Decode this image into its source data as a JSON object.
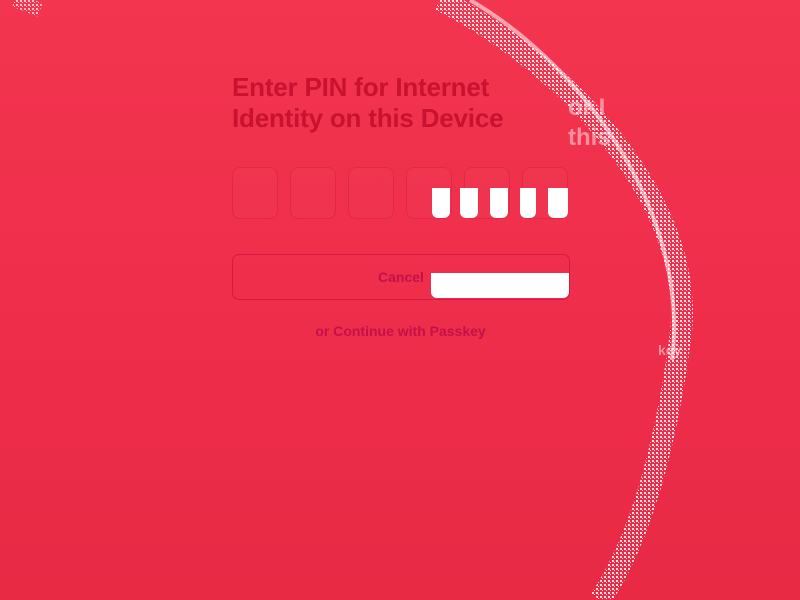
{
  "dialog": {
    "title": "Enter PIN for Internet Identity on this Device",
    "pin_digits": [
      "",
      "",
      "",
      "",
      "",
      ""
    ],
    "cancel_label": "Cancel",
    "passkey_link_label": "or Continue with Passkey"
  },
  "ghost": {
    "title_fragment": "or I\nthis",
    "link_fragment": "key"
  },
  "colors": {
    "background": "#f3354f",
    "title_text": "#c8122f",
    "button_text": "#c4104a",
    "glitch": "#ffffff"
  }
}
